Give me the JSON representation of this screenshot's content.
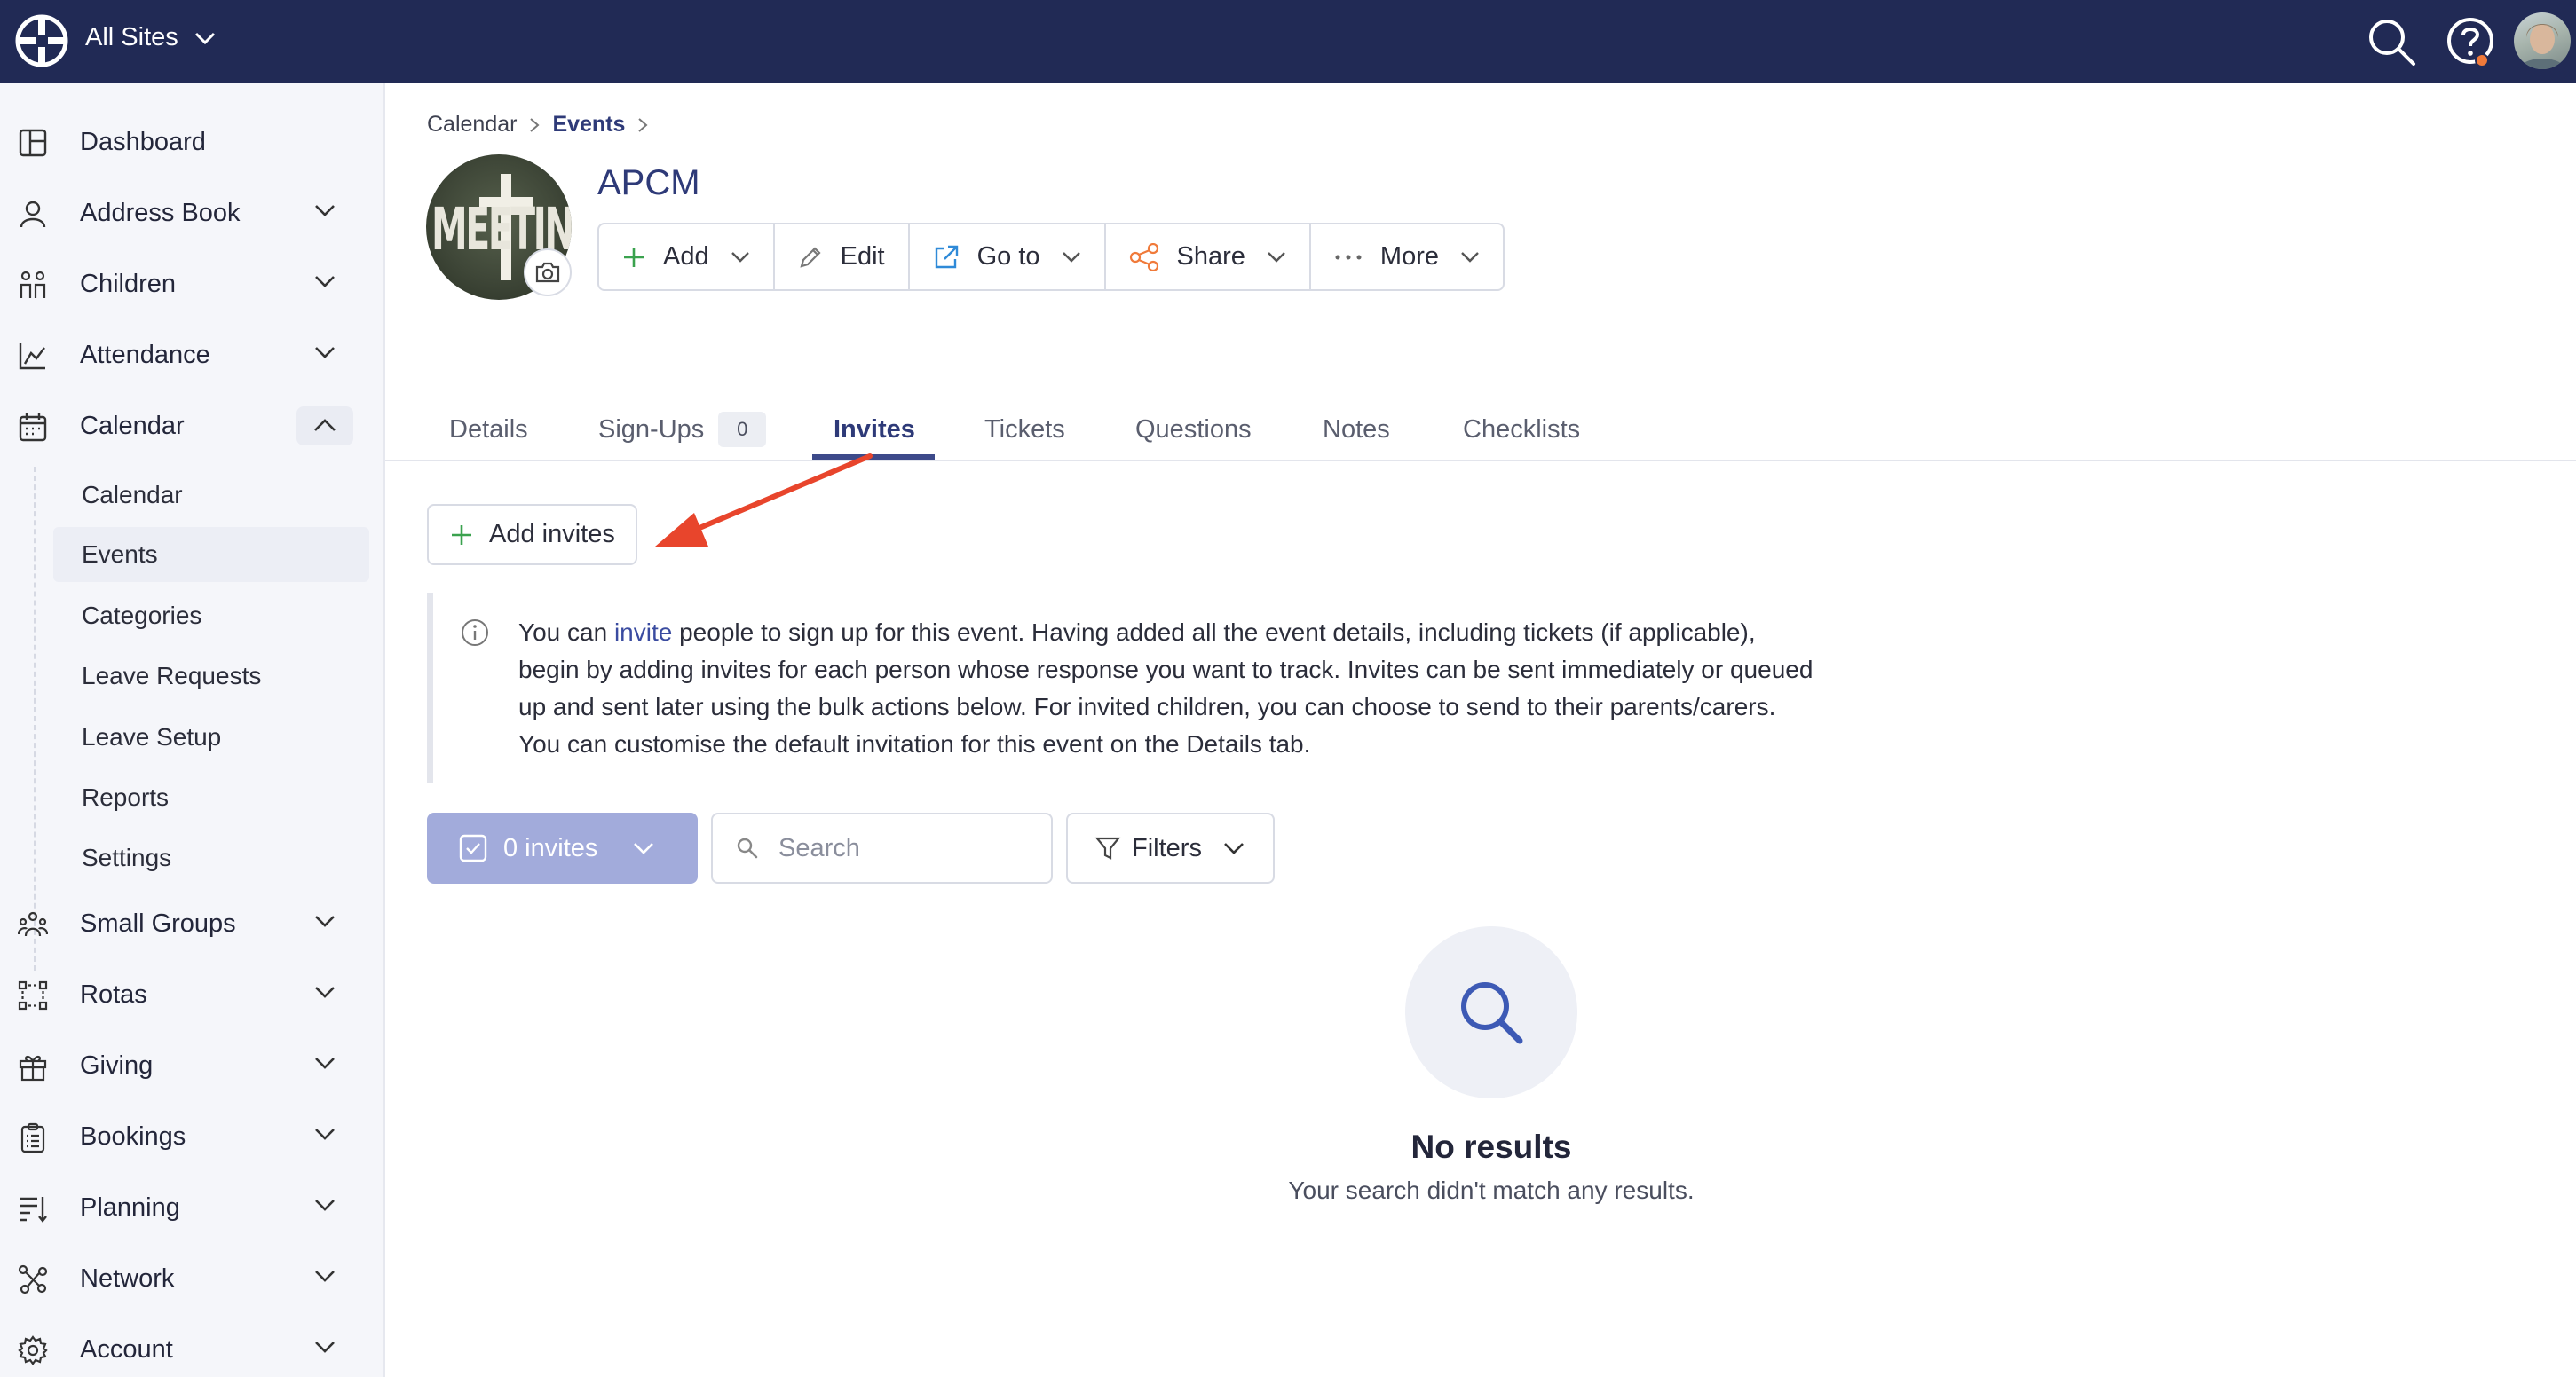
{
  "topbar": {
    "site_selector": "All Sites",
    "search_icon": "search-icon",
    "help_icon": "help-icon",
    "brand_color": "#212a55",
    "notification_color": "#f07a3a"
  },
  "sidebar": {
    "items": [
      {
        "label": "Dashboard",
        "icon": "dashboard-icon"
      },
      {
        "label": "Address Book",
        "icon": "person-icon"
      },
      {
        "label": "Children",
        "icon": "children-icon"
      },
      {
        "label": "Attendance",
        "icon": "chart-icon"
      },
      {
        "label": "Calendar",
        "icon": "calendar-icon",
        "expanded": true
      },
      {
        "label": "Small Groups",
        "icon": "groups-icon"
      },
      {
        "label": "Rotas",
        "icon": "rotas-icon"
      },
      {
        "label": "Giving",
        "icon": "gift-icon"
      },
      {
        "label": "Bookings",
        "icon": "clipboard-icon"
      },
      {
        "label": "Planning",
        "icon": "planning-icon"
      },
      {
        "label": "Network",
        "icon": "network-icon"
      },
      {
        "label": "Account",
        "icon": "gear-icon"
      }
    ],
    "calendar_subitems": [
      {
        "label": "Calendar"
      },
      {
        "label": "Events",
        "active": true
      },
      {
        "label": "Categories"
      },
      {
        "label": "Leave Requests"
      },
      {
        "label": "Leave Setup"
      },
      {
        "label": "Reports"
      },
      {
        "label": "Settings"
      }
    ]
  },
  "breadcrumb": {
    "items": [
      "Calendar",
      "Events"
    ]
  },
  "event": {
    "image_text": "MEETING",
    "title": "APCM"
  },
  "actions": {
    "add": "Add",
    "edit": "Edit",
    "goto": "Go to",
    "share": "Share",
    "more": "More"
  },
  "tabs": [
    {
      "label": "Details"
    },
    {
      "label": "Sign-Ups",
      "badge": "0"
    },
    {
      "label": "Invites",
      "active": true
    },
    {
      "label": "Tickets"
    },
    {
      "label": "Questions"
    },
    {
      "label": "Notes"
    },
    {
      "label": "Checklists"
    }
  ],
  "add_invites_label": "Add invites",
  "info": {
    "prefix": "You can ",
    "link": "invite",
    "line1_rest": " people to sign up for this event. Having added all the event details, including tickets (if applicable),",
    "line2": "begin by adding invites for each person whose response you want to track. Invites can be sent immediately or queued",
    "line3": "up and sent later using the bulk actions below. For invited children, you can choose to send to their parents/carers.",
    "line4": "You can customise the default invitation for this event on the Details tab."
  },
  "toolbar": {
    "invites_count": "0 invites",
    "search_placeholder": "Search",
    "filters": "Filters"
  },
  "empty": {
    "title": "No results",
    "subtitle": "Your search didn't match any results."
  },
  "colors": {
    "accent": "#2e3a78",
    "primary_button": "#a2abdb",
    "annotation_arrow": "#e8452c",
    "add_icon": "#3aa24e"
  }
}
